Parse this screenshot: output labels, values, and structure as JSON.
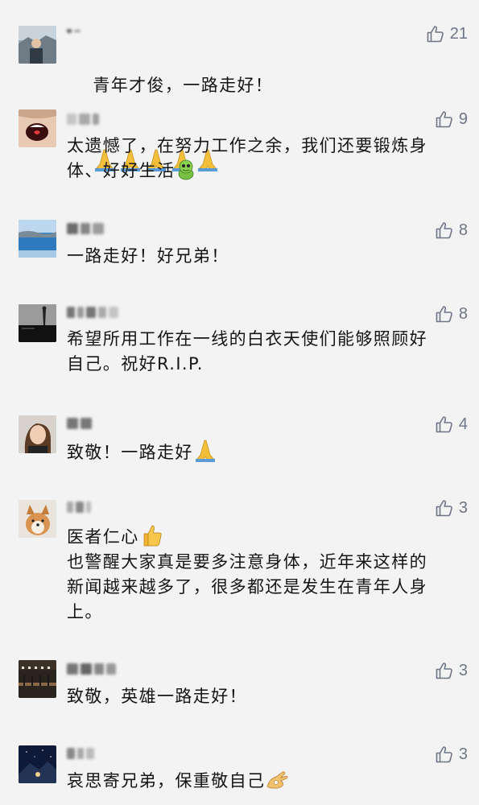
{
  "comments": [
    {
      "likes": "21",
      "text": "青年才俊，一路走好！",
      "emoji": "pray",
      "emoji_count": 5
    },
    {
      "likes": "9",
      "text": "太遗憾了，在努力工作之余，我们还要锻炼身\n体、好好生活",
      "emoji": "frog",
      "emoji_count": 1
    },
    {
      "likes": "8",
      "text": "一路走好！好兄弟！",
      "emoji": "",
      "emoji_count": 0
    },
    {
      "likes": "8",
      "text": "希望所用工作在一线的白衣天使们能够照顾好\n自己。祝好R.I.P.",
      "emoji": "",
      "emoji_count": 0
    },
    {
      "likes": "4",
      "text": "致敬！一路走好",
      "emoji": "pray",
      "emoji_count": 1
    },
    {
      "likes": "3",
      "text": "医者仁心",
      "emoji": "thumbs-up",
      "emoji_count": 1,
      "text2": "也警醒大家真是要多注意身体，近年来这样的\n新闻越来越多了，很多都还是发生在青年人身\n上。"
    },
    {
      "likes": "3",
      "text": "致敬，英雄一路走好！",
      "emoji": "",
      "emoji_count": 0
    },
    {
      "likes": "3",
      "text": "哀思寄兄弟，保重敬自己",
      "emoji": "ok-hand",
      "emoji_count": 1
    }
  ]
}
